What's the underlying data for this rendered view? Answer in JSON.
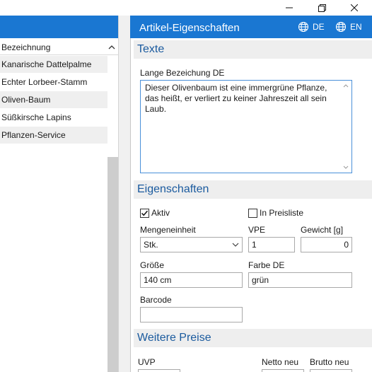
{
  "window": {
    "minimize_icon": "minimize-icon",
    "maximize_icon": "restore-icon",
    "close_icon": "close-icon"
  },
  "left": {
    "column_header": "Bezeichnung",
    "rows": [
      "Kanarische Dattelpalme",
      "Echter Lorbeer-Stamm",
      "Oliven-Baum",
      "Süßkirsche Lapins",
      "Pflanzen-Service"
    ]
  },
  "right": {
    "title": "Artikel-Eigenschaften",
    "lang_de": "DE",
    "lang_en": "EN",
    "sections": {
      "texte": "Texte",
      "eigenschaften": "Eigenschaften",
      "preise": "Weitere Preise"
    },
    "texte": {
      "long_label": "Lange Bezeichung DE",
      "long_value": "Dieser Olivenbaum ist eine immergrüne Pflanze, das heißt, er verliert zu keiner Jahreszeit all sein Laub."
    },
    "eigenschaften": {
      "aktiv_label": "Aktiv",
      "aktiv_checked": true,
      "preisliste_label": "In Preisliste",
      "preisliste_checked": false,
      "einheit_label": "Mengeneinheit",
      "einheit_value": "Stk.",
      "vpe_label": "VPE",
      "vpe_value": "1",
      "gewicht_label": "Gewicht [g]",
      "gewicht_value": "0",
      "groesse_label": "Größe",
      "groesse_value": "140 cm",
      "farbe_label": "Farbe DE",
      "farbe_value": "grün",
      "barcode_label": "Barcode",
      "barcode_value": ""
    },
    "preise": {
      "uvp_label": "UVP",
      "netto_label": "Netto neu",
      "brutto_label": "Brutto neu"
    }
  },
  "colors": {
    "accent": "#1a77d2",
    "section_text": "#1a5a9e",
    "section_bg": "#eeeeee"
  }
}
